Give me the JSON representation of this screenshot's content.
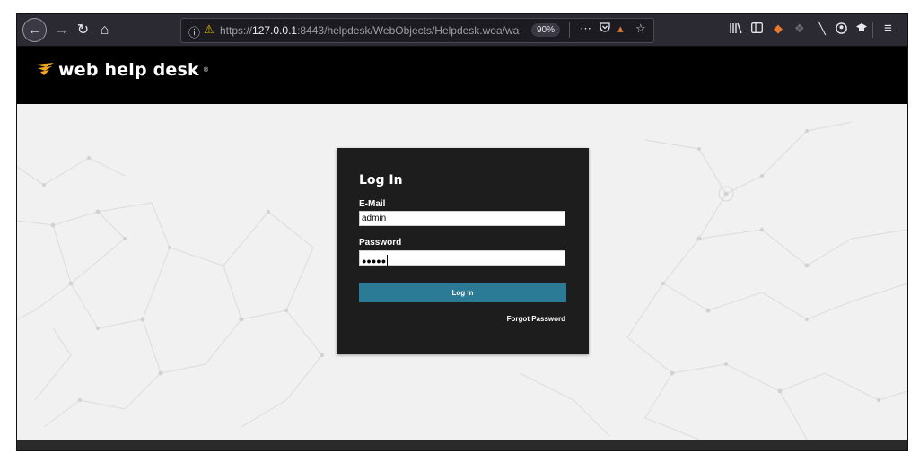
{
  "browser": {
    "url_scheme": "https://",
    "url_host": "127.0.0.1",
    "url_path": ":8443/helpdesk/WebObjects/Helpdesk.woa/wa",
    "zoom": "90%"
  },
  "icons": {
    "back": "arrow-left-icon",
    "forward": "arrow-right-icon",
    "reload": "reload-icon",
    "home": "home-icon",
    "info": "info-icon",
    "warning": "warning-icon",
    "more": "more-icon",
    "pocket": "pocket-icon",
    "star": "star-icon",
    "library": "library-icon",
    "sidebar": "sidebar-icon",
    "menu": "hamburger-menu-icon"
  },
  "app": {
    "logo_text": "web help desk",
    "logo_tm": "®",
    "brand_color": "#f5a623",
    "header_bg": "#000000"
  },
  "login": {
    "title": "Log In",
    "email_label": "E-Mail",
    "email_value": "admin",
    "password_label": "Password",
    "password_masked": "●●●●●",
    "button_label": "Log In",
    "button_color": "#2b7b96",
    "forgot_label": "Forgot Password"
  }
}
